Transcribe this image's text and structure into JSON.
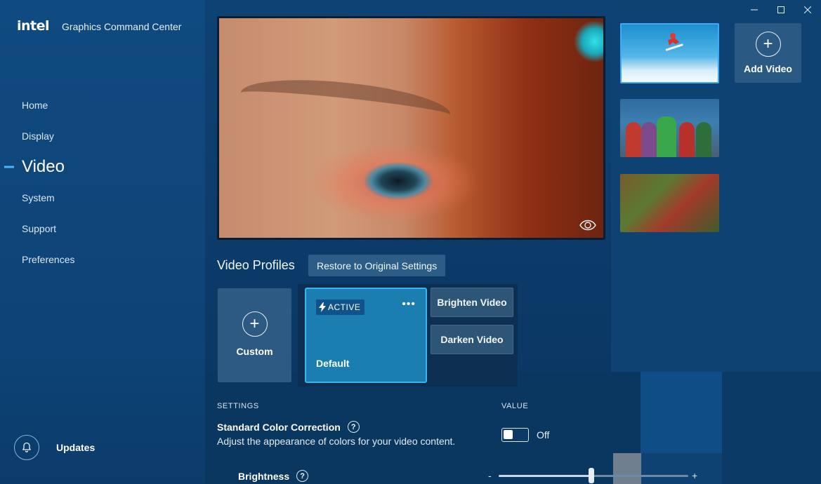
{
  "app": {
    "brand": "intel",
    "title": "Graphics Command Center"
  },
  "window_controls": {
    "minimize": "—",
    "maximize": "☐",
    "close": "✕"
  },
  "sidebar": {
    "items": [
      {
        "label": "Home",
        "active": false
      },
      {
        "label": "Display",
        "active": false
      },
      {
        "label": "Video",
        "active": true
      },
      {
        "label": "System",
        "active": false
      },
      {
        "label": "Support",
        "active": false
      },
      {
        "label": "Preferences",
        "active": false
      }
    ],
    "updates_label": "Updates"
  },
  "videos": {
    "add_label": "Add Video",
    "thumbnails": [
      {
        "icon": "snowboarder-thumbnail",
        "selected": true
      },
      {
        "icon": "group-portrait-thumbnail",
        "selected": false
      },
      {
        "icon": "market-thumbnail",
        "selected": false
      }
    ]
  },
  "profiles": {
    "title": "Video Profiles",
    "restore_label": "Restore to Original Settings",
    "custom_label": "Custom",
    "active_badge": "ACTIVE",
    "default_label": "Default",
    "more_label": "•••",
    "presets": [
      "Brighten Video",
      "Darken Video"
    ]
  },
  "settings": {
    "settings_header": "SETTINGS",
    "value_header": "VALUE",
    "color_correction": {
      "title": "Standard Color Correction",
      "description": "Adjust the appearance of colors for your video content.",
      "state_label": "Off",
      "enabled": false
    },
    "brightness": {
      "title": "Brightness",
      "min_symbol": "-",
      "max_symbol": "+",
      "level": 0.49
    },
    "help_symbol": "?"
  },
  "colors": {
    "accent": "#3cb4ef",
    "active_card": "#1a7fb0",
    "nav_indicator": "#4db3ff"
  }
}
